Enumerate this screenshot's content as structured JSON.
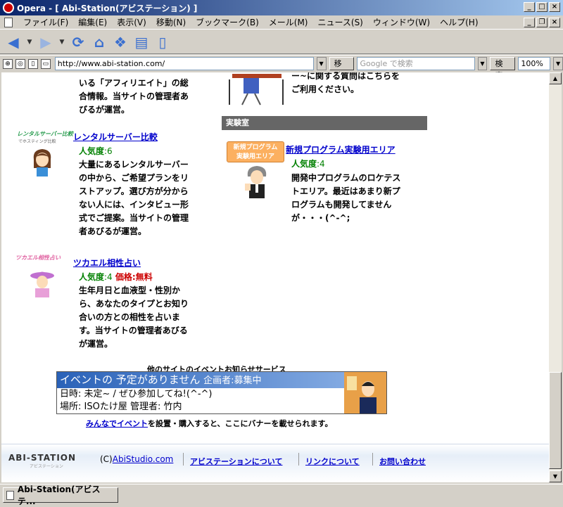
{
  "window": {
    "title": "Opera - [ Abi-Station(アビステーション) ]"
  },
  "menu": [
    "ファイル(F)",
    "編集(E)",
    "表示(V)",
    "移動(N)",
    "ブックマーク(B)",
    "メール(M)",
    "ニュース(S)",
    "ウィンドウ(W)",
    "ヘルプ(H)"
  ],
  "address": {
    "url": "http://www.abi-station.com/",
    "go_label": "移動",
    "search_placeholder": "Google で検索",
    "search_label": "検索",
    "zoom": "100%"
  },
  "left": {
    "top_text": [
      "いる「アフィリエイト」の総",
      "合情報。当サイトの管理者あ",
      "びるが運営。"
    ],
    "rental": {
      "logo": "レンタルサーバー比較",
      "logo_sub": "でホスティング比較",
      "title": "レンタルサーバー比較",
      "pop_label": "人気度",
      "pop_value": ":6",
      "desc": [
        "大量にあるレンタルサーバー",
        "の中から、ご希望プランをリ",
        "ストアップ。選び方が分から",
        "ない人には、インタビュー形",
        "式でご提案。当サイトの管理",
        "者あびるが運営。"
      ]
    },
    "tsukaeru": {
      "logo": "ツカエル相性占い",
      "title": "ツカエル相性占い",
      "pop_label": "人気度",
      "pop_value": ":4",
      "price_label": "価格",
      "price_value": ":無料",
      "desc": [
        "生年月日と血液型・性別か",
        "ら、あなたのタイプとお知り",
        "合いの方との相性を占いま",
        "す。当サイトの管理者あびる",
        "が運営。"
      ]
    }
  },
  "right": {
    "top_text": [
      "ー~に関する質問はこちらを",
      "ご利用ください。"
    ],
    "section_label": "実験室",
    "lab": {
      "tag": [
        "新規プログラム",
        "実験用エリア"
      ],
      "title": "新規プログラム実験用エリア",
      "pop_label": "人気度",
      "pop_value": ":4",
      "desc": [
        "開発中プログラムのロケテス",
        "トエリア。最近はあまり新プ",
        "ログラムも開発してません",
        "が・・・(^-^;"
      ]
    }
  },
  "banner": {
    "top_label": "他のサイトのイベントお知らせサービス",
    "head": "イベントの 予定がありません",
    "head_sub": "企画者:募集中",
    "line1": "日時: 未定~ / ぜひ参加してね!(^-^)",
    "line2": "場所: ISOたけ屋 管理者: 竹内",
    "note_link": "みんなでイベント",
    "note_text": "を設置・購入すると、ここにバナーを載せられます。"
  },
  "footer": {
    "logo": "ABI-STATION",
    "logo_sub": "アビステーション",
    "copy_prefix": "(C)",
    "copy_link": "AbiStudio.com",
    "links": [
      "アビステーションについて",
      "リンクについて",
      "お問い合わせ"
    ]
  },
  "statusbar": {
    "tab_label": "Abi-Station(アビステ..."
  }
}
